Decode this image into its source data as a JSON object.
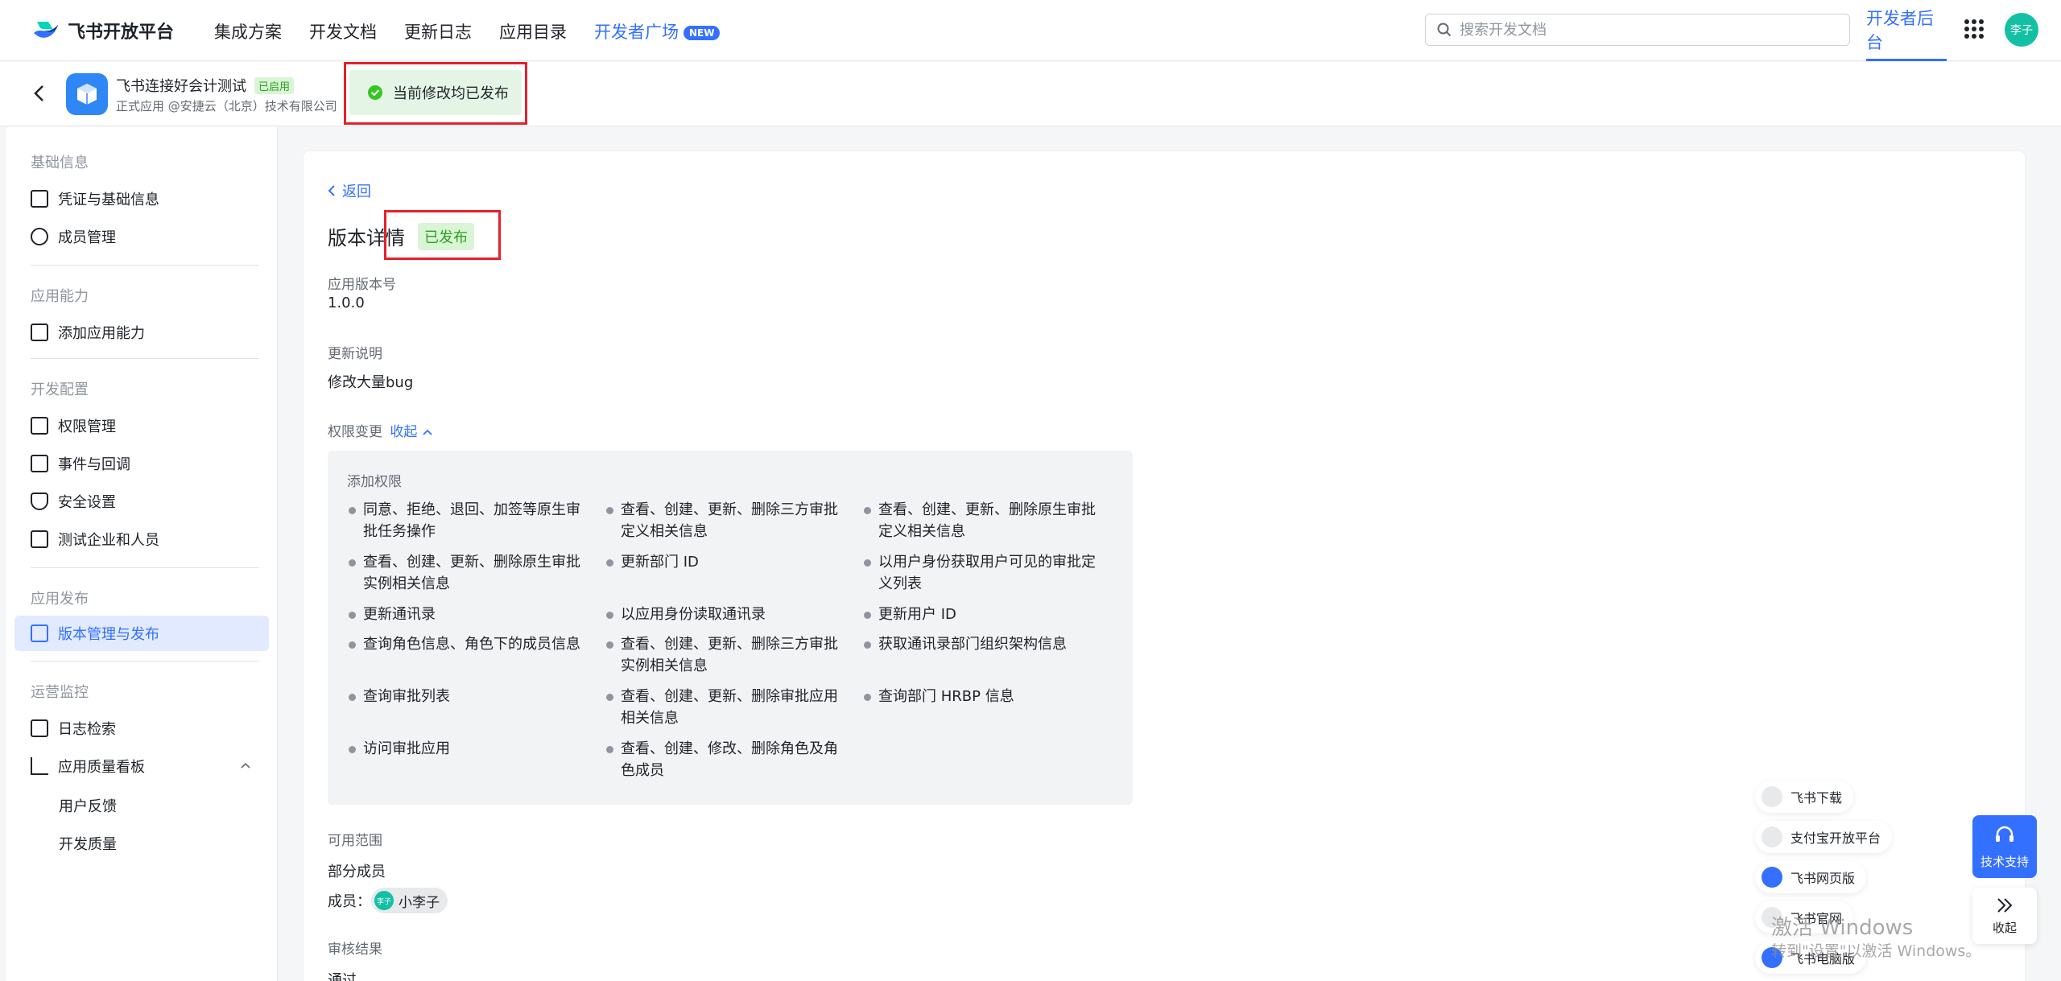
{
  "topnav": {
    "logo_text": "飞书开放平台",
    "links": [
      "集成方案",
      "开发文档",
      "更新日志",
      "应用目录"
    ],
    "dev_plaza": "开发者广场",
    "new_badge": "NEW",
    "search_placeholder": "搜索开发文档",
    "dev_backend": "开发者后台",
    "avatar_text": "李子",
    "accent": "#3370ff"
  },
  "app": {
    "name": "飞书连接好会计测试",
    "status_badge": "已启用",
    "subtitle": "正式应用 @安捷云（北京）技术有限公司",
    "toast": "当前修改均已发布"
  },
  "sidebar": {
    "groups": [
      "基础信息",
      "应用能力",
      "开发配置",
      "应用发布",
      "运营监控"
    ],
    "items": [
      {
        "label": "凭证与基础信息",
        "icon": "credential-icon"
      },
      {
        "label": "成员管理",
        "icon": "member-icon"
      },
      {
        "label": "添加应用能力",
        "icon": "add-capability-icon"
      },
      {
        "label": "权限管理",
        "icon": "lock-icon"
      },
      {
        "label": "事件与回调",
        "icon": "event-icon"
      },
      {
        "label": "安全设置",
        "icon": "shield-icon"
      },
      {
        "label": "测试企业和人员",
        "icon": "code-icon"
      },
      {
        "label": "版本管理与发布",
        "icon": "publish-icon"
      },
      {
        "label": "日志检索",
        "icon": "log-search-icon"
      },
      {
        "label": "应用质量看板",
        "icon": "chart-icon"
      }
    ],
    "sub_items": [
      "用户反馈",
      "开发质量"
    ]
  },
  "main": {
    "back": "返回",
    "title": "版本详情",
    "status": "已发布",
    "version_label": "应用版本号",
    "version_value": "1.0.0",
    "notes_label": "更新说明",
    "notes_value": "修改大量bug",
    "perm_change_label": "权限变更",
    "collapse": "收起",
    "perm_added_title": "添加权限",
    "perms": [
      "同意、拒绝、退回、加签等原生审批任务操作",
      "查看、创建、更新、删除三方审批定义相关信息",
      "查看、创建、更新、删除原生审批定义相关信息",
      "查看、创建、更新、删除原生审批实例相关信息",
      "更新部门 ID",
      "以用户身份获取用户可见的审批定义列表",
      "更新通讯录",
      "以应用身份读取通讯录",
      "更新用户 ID",
      "查询角色信息、角色下的成员信息",
      "查看、创建、更新、删除三方审批实例相关信息",
      "获取通讯录部门组织架构信息",
      "查询审批列表",
      "查看、创建、更新、删除审批应用相关信息",
      "查询部门 HRBP 信息",
      "访问审批应用",
      "查看、创建、修改、删除角色及角色成员"
    ],
    "scope_label": "可用范围",
    "scope_value": "部分成员",
    "member_label": "成员：",
    "member_avatar": "李子",
    "member_name": "小李子",
    "review_label": "审核结果",
    "review_value": "通过"
  },
  "floating": {
    "links": [
      "飞书下载",
      "支付宝开放平台",
      "飞书网页版",
      "飞书官网",
      "飞书电脑版"
    ],
    "support": "技术支持",
    "collapse": "收起"
  },
  "watermark": {
    "line1": "激活 Windows",
    "line2": "转到\"设置\"以激活 Windows。"
  }
}
